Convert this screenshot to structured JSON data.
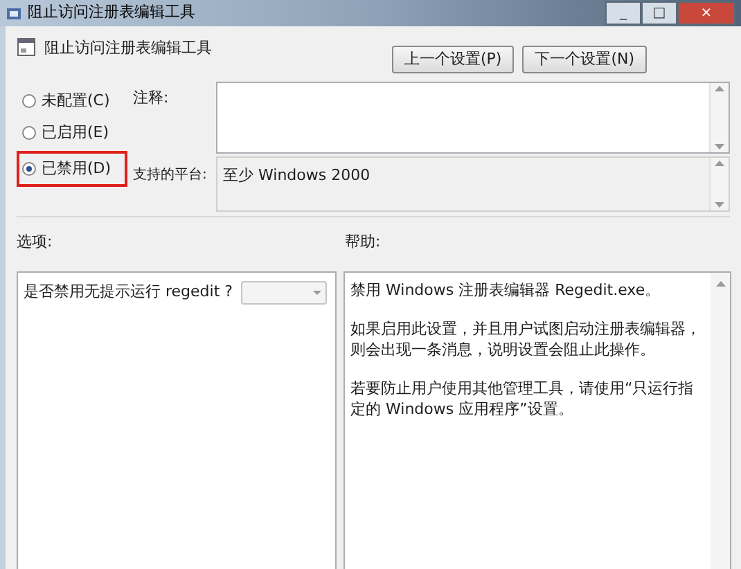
{
  "window": {
    "title": "阻止访问注册表编辑工具",
    "controls": [
      "_",
      "□",
      "×"
    ]
  },
  "header": {
    "title": "阻止访问注册表编辑工具",
    "buttons": [
      "上一个设置(P)",
      "下一个设置(N)"
    ]
  },
  "state_options": [
    {
      "label": "未配置(C)",
      "selected": false,
      "highlighted": false
    },
    {
      "label": "已启用(E)",
      "selected": false,
      "highlighted": false
    },
    {
      "label": "已禁用(D)",
      "selected": true,
      "highlighted": true
    }
  ],
  "comment": {
    "label": "注释:"
  },
  "platform": {
    "label": "支持的平台:",
    "value": "至少 Windows 2000"
  },
  "options": {
    "label": "选项:",
    "question": "是否禁用无提示运行 regedit ?",
    "dropdown": {
      "disabled": true
    }
  },
  "help": {
    "label": "帮助:",
    "paragraphs": [
      "禁用 Windows 注册表编辑器 Regedit.exe。",
      "如果启用此设置，并且用户试图启动注册表编辑器，则会出现一条消息，说明设置会阻止此操作。",
      "若要防止用户使用其他管理工具，请使用“只运行指定的 Windows 应用程序”设置。"
    ]
  }
}
